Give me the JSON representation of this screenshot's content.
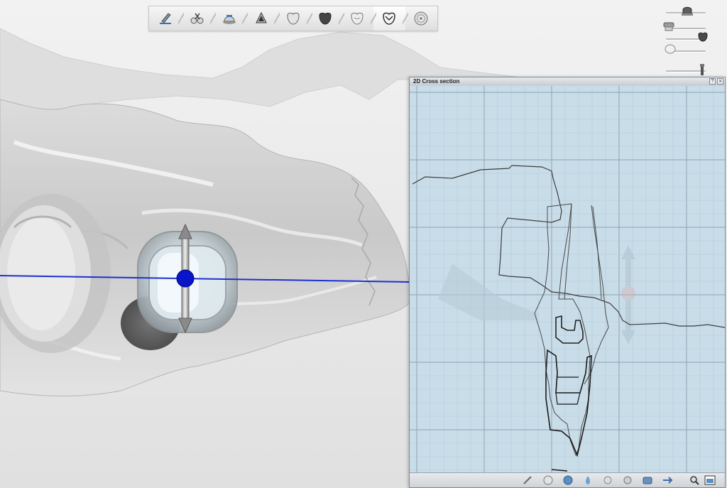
{
  "workflow_toolbar": {
    "steps": [
      {
        "name": "scan-step",
        "icon": "scan-icon"
      },
      {
        "name": "model-step",
        "icon": "model-tools-icon"
      },
      {
        "name": "abutment-step",
        "icon": "abutment-icon"
      },
      {
        "name": "crown-bottoms-step",
        "icon": "crown-bottom-icon"
      },
      {
        "name": "tooth-library-step",
        "icon": "tooth-library-icon"
      },
      {
        "name": "anatomy-step",
        "icon": "anatomy-tooth-icon"
      },
      {
        "name": "connector-step",
        "icon": "tooth-outline-icon"
      },
      {
        "name": "freeform-step",
        "icon": "freeform-tooth-icon"
      },
      {
        "name": "milling-step",
        "icon": "disc-icon"
      }
    ],
    "active_index": 7
  },
  "view_sliders": [
    {
      "name": "abutment-visibility-slider",
      "icon": "abutment-thumb-icon",
      "value": 0.72
    },
    {
      "name": "model-visibility-slider",
      "icon": "model-thumb-icon",
      "value": 0.0
    },
    {
      "name": "antagonist-visibility-slider",
      "icon": "antagonist-thumb-icon",
      "value": 0.85
    },
    {
      "name": "gingiva-visibility-slider",
      "icon": "gingiva-thumb-icon",
      "value": 0.0
    },
    {
      "name": "implant-visibility-slider",
      "icon": "implant-thumb-icon",
      "value": 0.95
    }
  ],
  "cross_section": {
    "title": "2D Cross section",
    "help_label": "?",
    "close_label": "x",
    "colors": {
      "background": "#c9dde9",
      "minor_grid": "#b4cad8",
      "major_grid": "#8aa3b4",
      "outline": "#2a2a2a"
    }
  },
  "viewport": {
    "section_line_color": "#1f2fd0",
    "manipulator_color": "#0a14c8"
  },
  "panel_tools": [
    {
      "name": "tool-sculpt",
      "icon": "sculpt-icon"
    },
    {
      "name": "tool-smooth",
      "icon": "smooth-icon"
    },
    {
      "name": "tool-morph",
      "icon": "morph-icon"
    },
    {
      "name": "tool-add",
      "icon": "drop-icon"
    },
    {
      "name": "tool-remove",
      "icon": "minus-icon"
    },
    {
      "name": "tool-shape",
      "icon": "shape-icon"
    },
    {
      "name": "tool-abutment",
      "icon": "abutment-tool-icon"
    },
    {
      "name": "tool-flip",
      "icon": "flip-icon"
    },
    {
      "name": "tool-zoom",
      "icon": "magnifier-icon"
    },
    {
      "name": "tool-layout",
      "icon": "layout-icon"
    }
  ]
}
